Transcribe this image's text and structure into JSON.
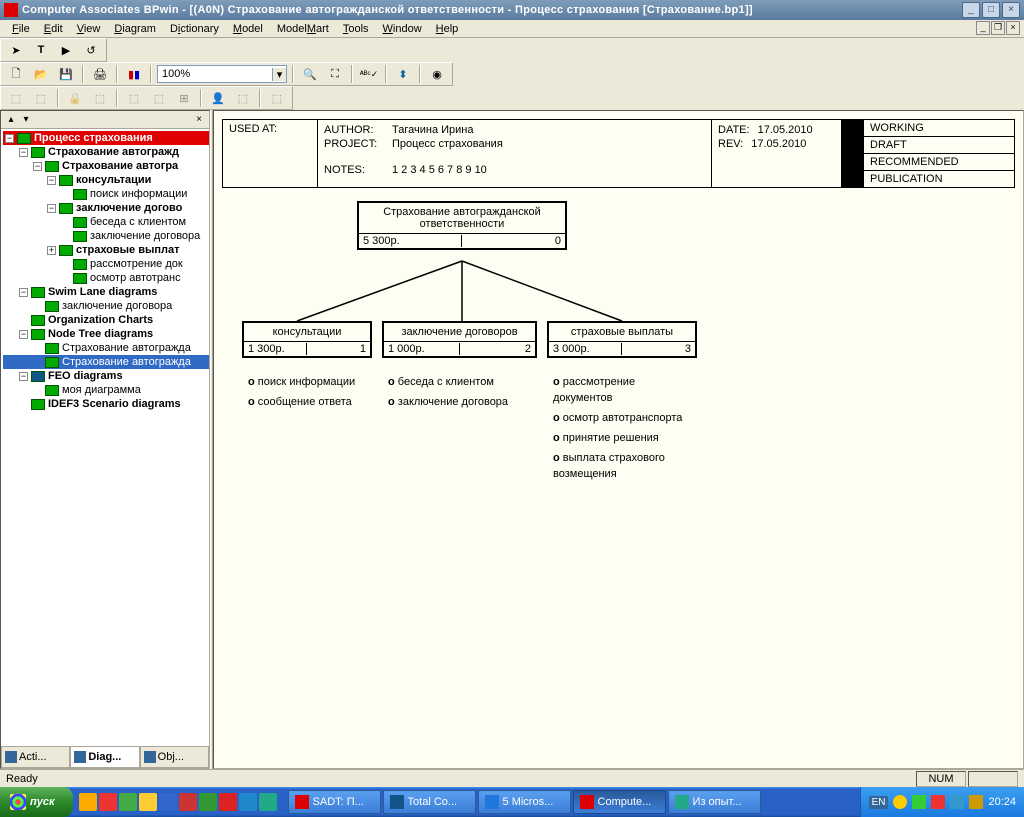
{
  "title": "Computer Associates BPwin - [(A0N) Страхование автогражданской  ответственности - Процесс страхования  [Страхование.bp1]]",
  "menu": [
    "File",
    "Edit",
    "View",
    "Diagram",
    "Dictionary",
    "Model",
    "ModelMart",
    "Tools",
    "Window",
    "Help"
  ],
  "zoom": "100%",
  "tree": {
    "root": "Процесс страхования",
    "items": [
      {
        "d": 0,
        "exp": "-",
        "label": "Процесс страхования",
        "sel": "root"
      },
      {
        "d": 1,
        "exp": "-",
        "label": "Страхование автогражд"
      },
      {
        "d": 2,
        "exp": "-",
        "label": "Страхование автогра"
      },
      {
        "d": 3,
        "exp": "-",
        "label": "консультации"
      },
      {
        "d": 4,
        "label": "поиск информации",
        "norm": true
      },
      {
        "d": 3,
        "exp": "-",
        "label": "заключение догово"
      },
      {
        "d": 4,
        "label": "беседа с клиентом",
        "norm": true
      },
      {
        "d": 4,
        "label": "заключение договора",
        "norm": true
      },
      {
        "d": 3,
        "exp": "+",
        "label": "страховые выплат"
      },
      {
        "d": 4,
        "label": "рассмотрение док",
        "norm": true
      },
      {
        "d": 4,
        "label": "осмотр автотранс",
        "norm": true
      },
      {
        "d": 1,
        "exp": "-",
        "label": "Swim Lane diagrams"
      },
      {
        "d": 2,
        "label": "заключение договора",
        "norm": true
      },
      {
        "d": 1,
        "label": "Organization Charts"
      },
      {
        "d": 1,
        "exp": "-",
        "label": "Node Tree diagrams"
      },
      {
        "d": 2,
        "label": "Страхование автогражда",
        "norm": true
      },
      {
        "d": 2,
        "label": "Страхование автогражда",
        "sel": "blue",
        "norm": true
      },
      {
        "d": 1,
        "exp": "-",
        "label": "FEO diagrams",
        "feo": true
      },
      {
        "d": 2,
        "label": "моя диаграмма",
        "norm": true
      },
      {
        "d": 1,
        "label": "IDEF3 Scenario diagrams"
      }
    ],
    "tabs": [
      "Acti...",
      "Diag...",
      "Obj..."
    ]
  },
  "header": {
    "used_at": "USED AT:",
    "author_lbl": "AUTHOR:",
    "author": "Тагачина Ирина",
    "project_lbl": "PROJECT:",
    "project": "Процесс страхования",
    "notes_lbl": "NOTES:",
    "notes": "1  2  3  4  5  6  7  8  9  10",
    "date_lbl": "DATE:",
    "date": "17.05.2010",
    "rev_lbl": "REV:",
    "rev": "17.05.2010",
    "status": [
      "WORKING",
      "DRAFT",
      "RECOMMENDED",
      "PUBLICATION"
    ]
  },
  "nodes": {
    "root": {
      "title": "Страхование автогражданской ответственности",
      "cost": "5 300р.",
      "num": "0"
    },
    "children": [
      {
        "title": "консультации",
        "cost": "1 300р.",
        "num": "1",
        "bullets": [
          "поиск информации",
          "сообщение ответа"
        ]
      },
      {
        "title": "заключение договоров",
        "cost": "1 000р.",
        "num": "2",
        "bullets": [
          "беседа с клиентом",
          "заключение договора"
        ]
      },
      {
        "title": "страховые выплаты",
        "cost": "3 000р.",
        "num": "3",
        "bullets": [
          "рассмотрение документов",
          "осмотр автотранспорта",
          "принятие решения",
          "выплата страхового возмещения"
        ]
      }
    ]
  },
  "status": {
    "ready": "Ready",
    "num": "NUM"
  },
  "taskbar": {
    "start": "пуск",
    "tasks": [
      {
        "label": "SADT: П...",
        "ico": "#d00"
      },
      {
        "label": "Total Co...",
        "ico": "#158"
      },
      {
        "label": "5 Micros...",
        "ico": "#27d"
      },
      {
        "label": "Compute...",
        "ico": "#d00",
        "active": true
      },
      {
        "label": "Из опыт...",
        "ico": "#2a8"
      }
    ],
    "lang": "EN",
    "time": "20:24"
  }
}
